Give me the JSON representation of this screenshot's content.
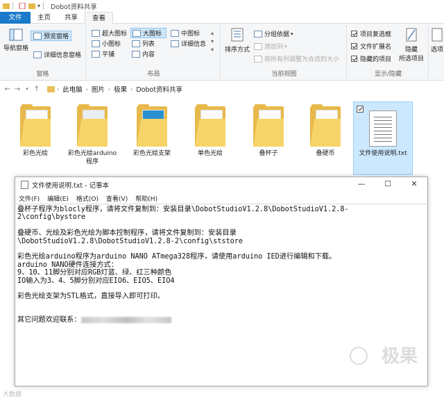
{
  "titlebar": {
    "title": "Dobot资料共享"
  },
  "ribbon": {
    "tabs": [
      "文件",
      "主页",
      "共享",
      "查看"
    ],
    "groups": {
      "panes": {
        "label": "窗格",
        "nav_pane": "导航窗格",
        "preview_pane": "预览窗格",
        "details_pane": "详细信息窗格"
      },
      "layout": {
        "label": "布局",
        "items": [
          "超大图标",
          "大图标",
          "中图标",
          "小图标",
          "列表",
          "详细信息",
          "平铺",
          "内容"
        ],
        "selected": "大图标"
      },
      "current_view": {
        "label": "当前视图",
        "sort_by": "排序方式",
        "group_by": "分组依据",
        "add_column": "添加列",
        "size_all_columns": "将所有列调整为合适的大小"
      },
      "show_hide": {
        "label": "显示/隐藏",
        "item_checkboxes": "项目复选框",
        "file_extensions": "文件扩展名",
        "hidden_items": "隐藏的项目",
        "hide_selected": "隐藏",
        "hide_selected_2": "所选项目",
        "options": "选项"
      }
    }
  },
  "address": {
    "crumbs": [
      "此电脑",
      "图片",
      "极果",
      "Dobot资料共享"
    ]
  },
  "files": [
    {
      "name": "彩色光绘",
      "type": "folder"
    },
    {
      "name": "彩色光绘arduino\n程序",
      "type": "folder"
    },
    {
      "name": "彩色光绘支架",
      "type": "folder"
    },
    {
      "name": "单色光绘",
      "type": "folder"
    },
    {
      "name": "叠杯子",
      "type": "folder"
    },
    {
      "name": "叠硬币",
      "type": "folder"
    },
    {
      "name": "文件使用说明.txt",
      "type": "txt"
    }
  ],
  "notepad": {
    "title": "文件使用说明.txt - 记事本",
    "menu": [
      "文件(F)",
      "编辑(E)",
      "格式(O)",
      "查看(V)",
      "帮助(H)"
    ],
    "lines": [
      "叠杯子程序为blocly程序，请将文件复制到：安装目录\\DobotStudioV1.2.8\\DobotStudioV1.2.8-",
      "2\\config\\bystore",
      "",
      "叠硬币、光绘及彩色光绘为脚本控制程序，请将文件复制到：安装目录",
      "\\DobotStudioV1.2.8\\DobotStudioV1.2.8-2\\config\\ststore",
      "",
      "彩色光绘arduino程序为arduino NANO ATmega328程序，请使用arduino IED进行编辑和下载。",
      "arduino NANO硬件连接方式：",
      "9、10、11脚分别对应RGB灯蓝、绿、红三种颜色",
      "IO输入为3、4、5脚分别对应EIO6、EIO5、EIO4",
      "",
      "彩色光绘支架为STL格式，直接导入即可打印。",
      "",
      "",
      "其它问题欢迎联系："
    ]
  },
  "watermark": {
    "logo": "极果",
    "bottom": "大数据"
  }
}
